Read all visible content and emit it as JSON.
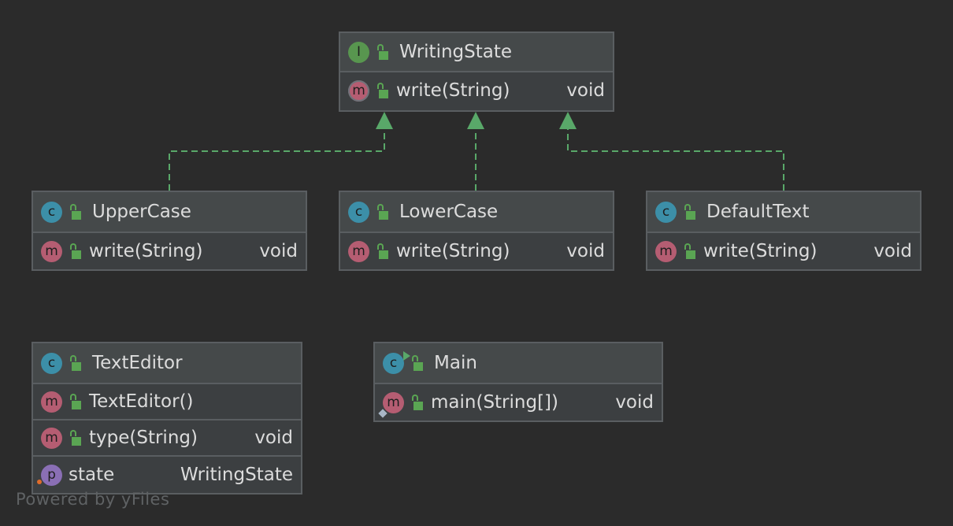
{
  "diagram": {
    "nodes": {
      "writing_state": {
        "badge": "I",
        "name": "WritingState",
        "members": [
          {
            "badge": "m",
            "name": "write(String)",
            "type": "void"
          }
        ]
      },
      "upper_case": {
        "badge": "c",
        "name": "UpperCase",
        "members": [
          {
            "badge": "m",
            "name": "write(String)",
            "type": "void"
          }
        ]
      },
      "lower_case": {
        "badge": "c",
        "name": "LowerCase",
        "members": [
          {
            "badge": "m",
            "name": "write(String)",
            "type": "void"
          }
        ]
      },
      "default_text": {
        "badge": "c",
        "name": "DefaultText",
        "members": [
          {
            "badge": "m",
            "name": "write(String)",
            "type": "void"
          }
        ]
      },
      "text_editor": {
        "badge": "c",
        "name": "TextEditor",
        "members": [
          {
            "badge": "m",
            "name": "TextEditor()",
            "type": ""
          },
          {
            "badge": "m",
            "name": "type(String)",
            "type": "void"
          },
          {
            "badge": "p",
            "name": "state",
            "type": "WritingState"
          }
        ]
      },
      "main": {
        "badge": "c",
        "name": "Main",
        "members": [
          {
            "badge": "m",
            "name": "main(String[])",
            "type": "void"
          }
        ]
      }
    },
    "edges": [
      {
        "from": "UpperCase",
        "to": "WritingState",
        "kind": "implements"
      },
      {
        "from": "LowerCase",
        "to": "WritingState",
        "kind": "implements"
      },
      {
        "from": "DefaultText",
        "to": "WritingState",
        "kind": "implements"
      }
    ],
    "colors": {
      "background": "#2b2b2b",
      "node_fill": "#3c3f41",
      "node_border": "#5a5e61",
      "edge": "#59a869",
      "class_badge": "#3c8fa8",
      "interface_badge": "#58964f",
      "method_badge": "#b55d72",
      "property_badge": "#8a6fb5"
    },
    "icons": {
      "class": "class-icon",
      "interface": "interface-icon",
      "method": "method-icon",
      "property": "property-icon",
      "visibility": "public-lock-icon"
    }
  },
  "watermark": "Powered by yFiles"
}
